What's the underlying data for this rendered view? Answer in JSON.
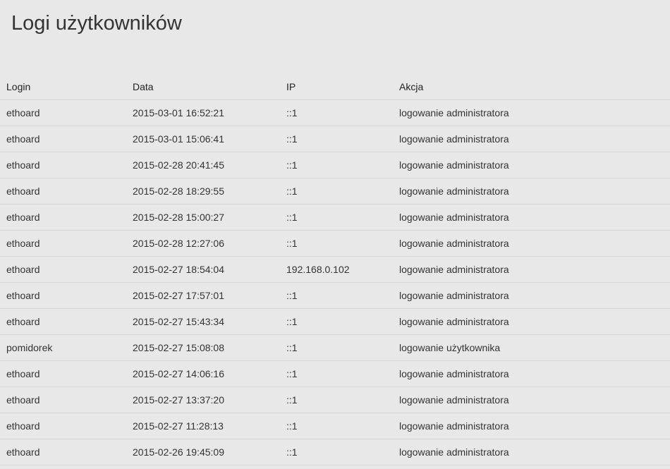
{
  "page": {
    "title": "Logi użytkowników"
  },
  "table": {
    "columns": [
      "Login",
      "Data",
      "IP",
      "Akcja"
    ],
    "rows": [
      {
        "login": "ethoard",
        "date": "2015-03-01 16:52:21",
        "ip": "::1",
        "action": "logowanie administratora"
      },
      {
        "login": "ethoard",
        "date": "2015-03-01 15:06:41",
        "ip": "::1",
        "action": "logowanie administratora"
      },
      {
        "login": "ethoard",
        "date": "2015-02-28 20:41:45",
        "ip": "::1",
        "action": "logowanie administratora"
      },
      {
        "login": "ethoard",
        "date": "2015-02-28 18:29:55",
        "ip": "::1",
        "action": "logowanie administratora"
      },
      {
        "login": "ethoard",
        "date": "2015-02-28 15:00:27",
        "ip": "::1",
        "action": "logowanie administratora"
      },
      {
        "login": "ethoard",
        "date": "2015-02-28 12:27:06",
        "ip": "::1",
        "action": "logowanie administratora"
      },
      {
        "login": "ethoard",
        "date": "2015-02-27 18:54:04",
        "ip": "192.168.0.102",
        "action": "logowanie administratora"
      },
      {
        "login": "ethoard",
        "date": "2015-02-27 17:57:01",
        "ip": "::1",
        "action": "logowanie administratora"
      },
      {
        "login": "ethoard",
        "date": "2015-02-27 15:43:34",
        "ip": "::1",
        "action": "logowanie administratora"
      },
      {
        "login": "pomidorek",
        "date": "2015-02-27 15:08:08",
        "ip": "::1",
        "action": "logowanie użytkownika"
      },
      {
        "login": "ethoard",
        "date": "2015-02-27 14:06:16",
        "ip": "::1",
        "action": "logowanie administratora"
      },
      {
        "login": "ethoard",
        "date": "2015-02-27 13:37:20",
        "ip": "::1",
        "action": "logowanie administratora"
      },
      {
        "login": "ethoard",
        "date": "2015-02-27 11:28:13",
        "ip": "::1",
        "action": "logowanie administratora"
      },
      {
        "login": "ethoard",
        "date": "2015-02-26 19:45:09",
        "ip": "::1",
        "action": "logowanie administratora"
      }
    ]
  }
}
